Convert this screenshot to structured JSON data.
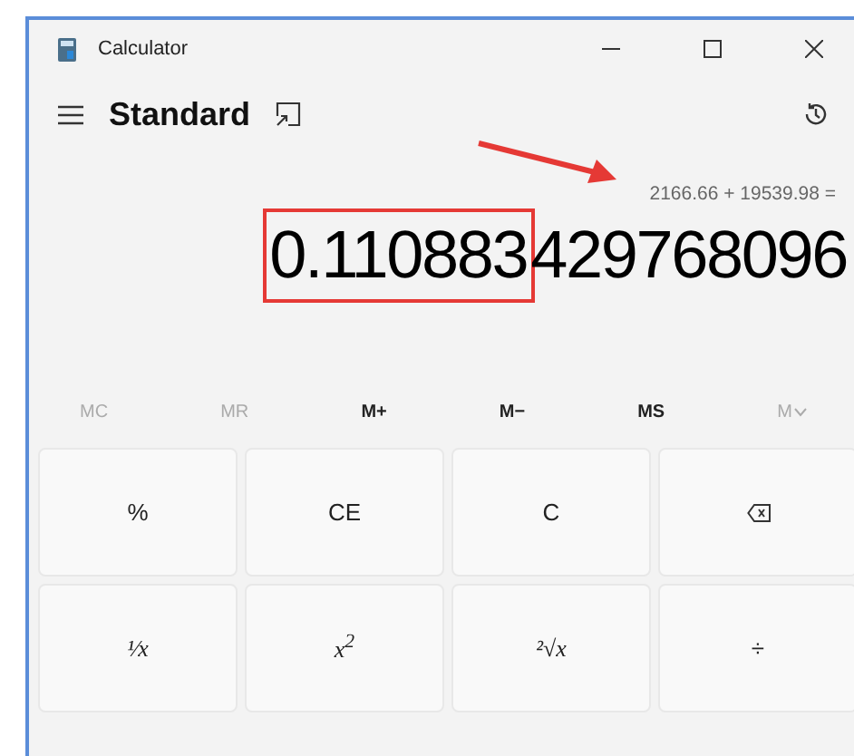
{
  "window": {
    "title": "Calculator"
  },
  "mode": {
    "title": "Standard"
  },
  "expression": "2166.66 + 19539.98 =",
  "display": {
    "highlighted": "0.110883",
    "rest": "429768096"
  },
  "memory": [
    {
      "label": "MC",
      "disabled": true,
      "kind": "text"
    },
    {
      "label": "MR",
      "disabled": true,
      "kind": "text"
    },
    {
      "label": "M+",
      "disabled": false,
      "kind": "text"
    },
    {
      "label": "M−",
      "disabled": false,
      "kind": "text"
    },
    {
      "label": "MS",
      "disabled": false,
      "kind": "text"
    },
    {
      "label": "M",
      "disabled": true,
      "kind": "dropdown"
    }
  ],
  "keys": [
    {
      "label": "%",
      "kind": "text"
    },
    {
      "label": "CE",
      "kind": "text"
    },
    {
      "label": "C",
      "kind": "text"
    },
    {
      "kind": "backspace"
    },
    {
      "label": "¹⁄x",
      "kind": "math"
    },
    {
      "label": "x$^{2}$",
      "kind": "math"
    },
    {
      "label": "²√x",
      "kind": "math"
    },
    {
      "label": "÷",
      "kind": "text"
    }
  ]
}
